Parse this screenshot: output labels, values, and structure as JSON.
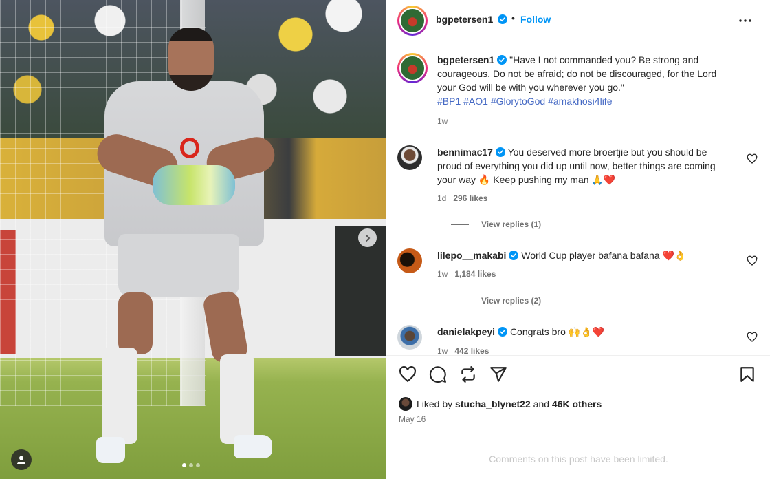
{
  "post": {
    "author": "bgpetersen1",
    "follow_label": "Follow",
    "separator": "•",
    "caption": "\"Have I not commanded you? Be strong and courageous. Do not be afraid; do not be discouraged, for the Lord your God will be with you wherever you go.\"",
    "hashtags": "#BP1 #AO1 #GlorytoGod #amakhosi4life",
    "caption_age": "1w",
    "carousel_total": 3,
    "carousel_index": 1
  },
  "comments": [
    {
      "user": "bennimac17",
      "text": "You deserved more broertjie but you should be proud of everything you did up until now, better things are coming your way 🔥 Keep pushing my man 🙏❤️",
      "age": "1d",
      "likes": "296 likes",
      "replies_label": "View replies (1)"
    },
    {
      "user": "lilepo__makabi",
      "text": "World Cup player bafana bafana ❤️👌",
      "age": "1w",
      "likes": "1,184 likes",
      "replies_label": "View replies (2)"
    },
    {
      "user": "danielakpeyi",
      "text": "Congrats bro 🙌👌❤️",
      "age": "1w",
      "likes": "442 likes"
    }
  ],
  "engagement": {
    "liked_by_prefix": "Liked by",
    "liked_by_user": "stucha_blynet22",
    "liked_by_and": "and",
    "liked_by_others": "46K others",
    "date": "May 16"
  },
  "footer": {
    "limited_notice": "Comments on this post have been limited."
  },
  "colors": {
    "link_blue": "#0095f6",
    "hashtag": "#4569c4",
    "verified": "#0095f6",
    "like_red": "#ff3040"
  },
  "icons": [
    "chevron-right-icon",
    "user-tag-icon",
    "verified-icon",
    "more-icon",
    "heart-icon",
    "comment-icon",
    "repost-icon",
    "share-icon",
    "bookmark-icon"
  ]
}
